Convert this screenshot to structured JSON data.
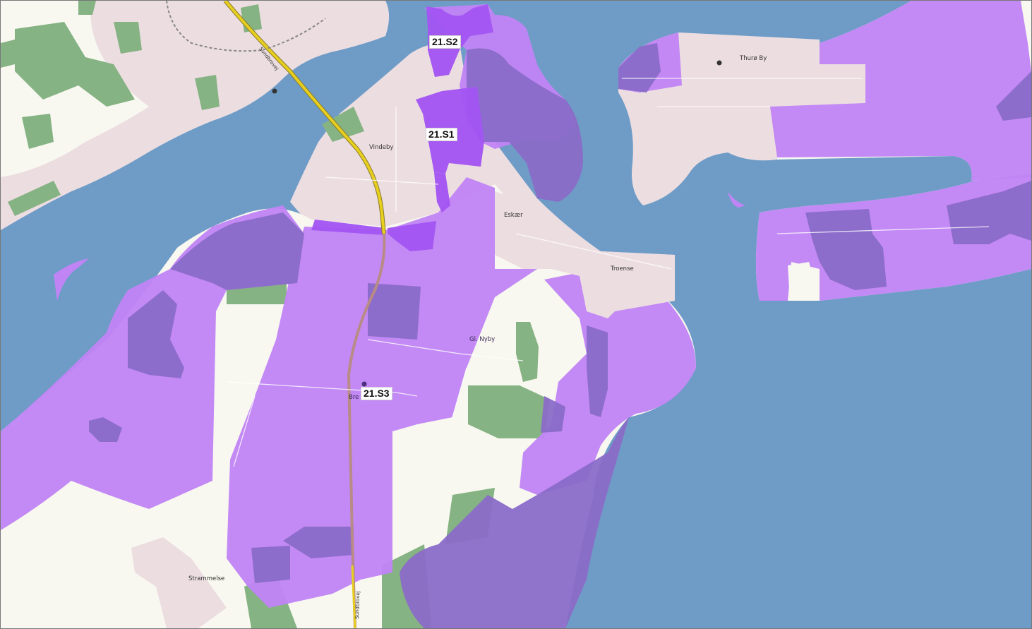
{
  "map": {
    "colors": {
      "water": "#6f9cc7",
      "land": "#f8f8f0",
      "urban": "#ecdde1",
      "forest": "#86b383",
      "zone_light": "#c184f5",
      "zone_medium": "#8a6cc8",
      "zone_bright": "#a356f2",
      "highway": "#e6cf1f",
      "main_road": "#b88b86"
    },
    "zones": [
      {
        "id": "21.S2",
        "label": "21.S2"
      },
      {
        "id": "21.S1",
        "label": "21.S1"
      },
      {
        "id": "21.S3",
        "label": "21.S3"
      }
    ],
    "places": {
      "vindeby": "Vindeby",
      "eskaer": "Eskær",
      "troense": "Troense",
      "thuro_by": "Thurø By",
      "gl_nyby": "Gl. Nyby",
      "bregninge": "Bre",
      "strammelse": "Strammelse"
    },
    "roads": {
      "sundbrovej_north": "Sundbrovej",
      "sundbrovej_south": "Sundbrovej"
    }
  }
}
